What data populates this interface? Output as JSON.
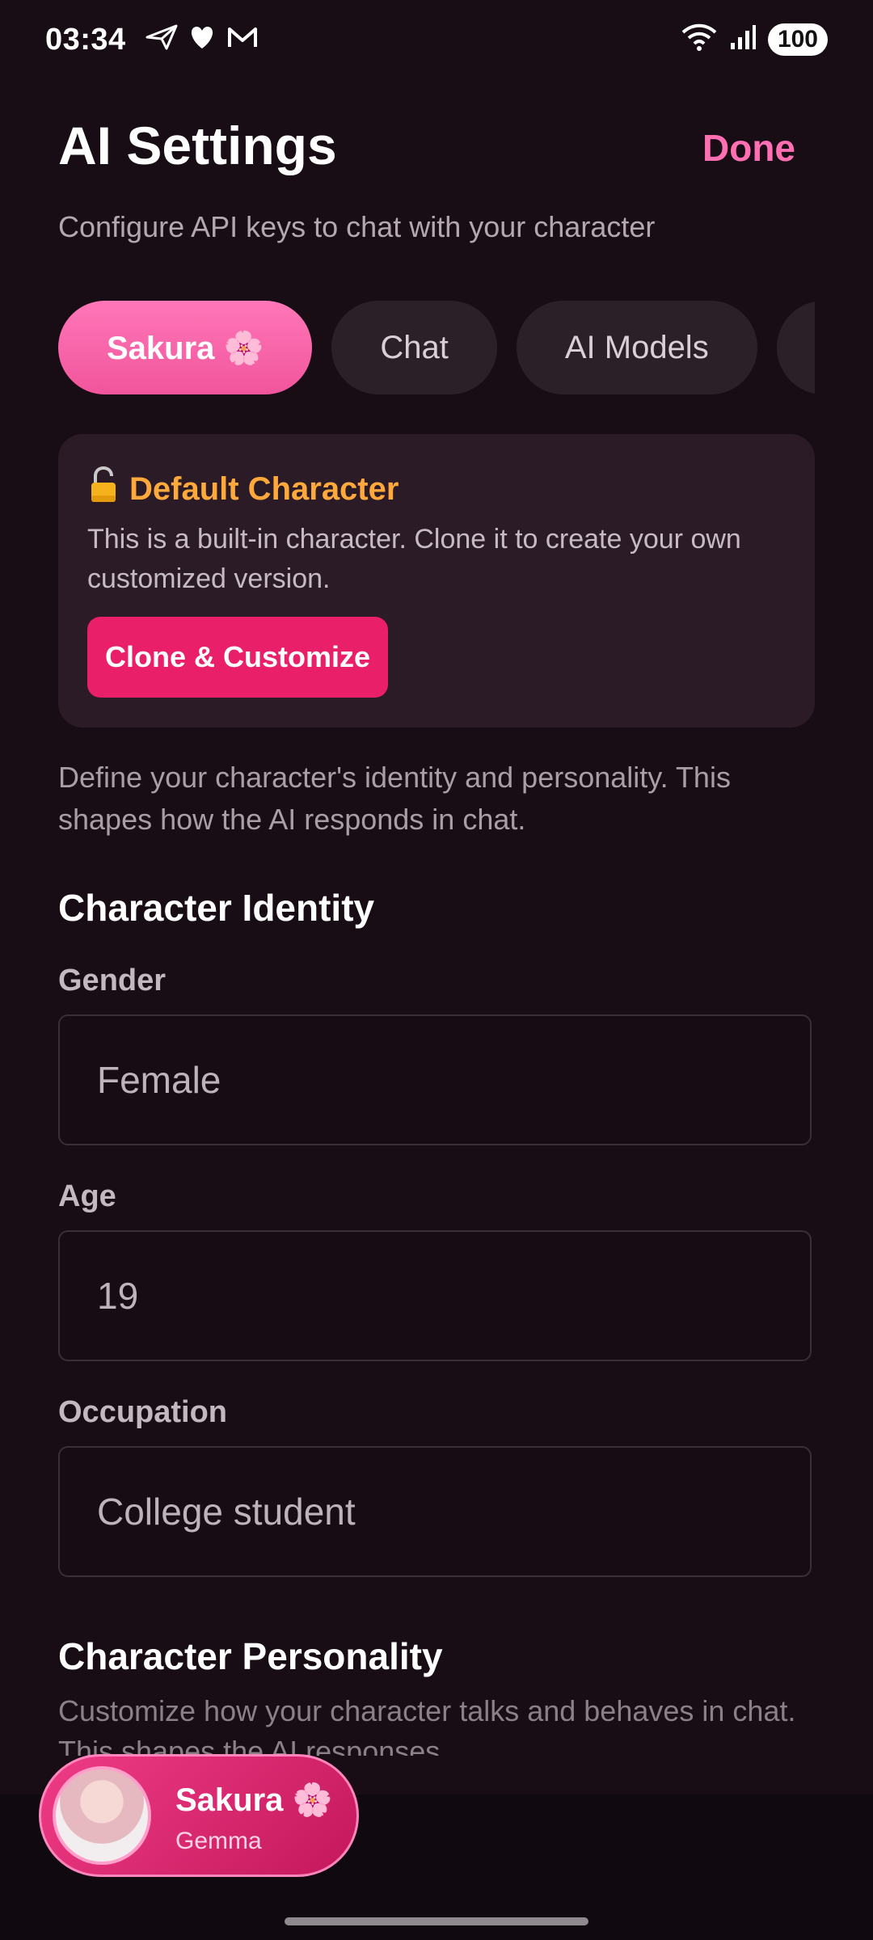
{
  "status_bar": {
    "time": "03:34",
    "left_icons": [
      "send-icon",
      "heart-icon",
      "mail-icon"
    ],
    "right_icons": [
      "wifi-icon",
      "signal-icon"
    ],
    "battery": "100"
  },
  "header": {
    "title": "AI Settings",
    "done_label": "Done",
    "subtitle": "Configure API keys to chat with your character"
  },
  "tabs": [
    {
      "label": "Sakura 🌸",
      "active": true
    },
    {
      "label": "Chat",
      "active": false
    },
    {
      "label": "AI Models",
      "active": false
    },
    {
      "label": "",
      "active": false
    }
  ],
  "default_card": {
    "icon": "lock-icon",
    "title": "Default Character",
    "text": "This is a built-in character. Clone it to create your own customized version.",
    "button_label": "Clone & Customize"
  },
  "intro_text": "Define your character's identity and personality. This shapes how the AI responds in chat.",
  "identity": {
    "heading": "Character Identity",
    "gender": {
      "label": "Gender",
      "value": "Female"
    },
    "age": {
      "label": "Age",
      "value": "19"
    },
    "occupation": {
      "label": "Occupation",
      "value": "College student"
    }
  },
  "personality": {
    "heading": "Character Personality",
    "text": "Customize how your character talks and behaves in chat. This shapes the AI responses."
  },
  "bottom": {
    "character_name": "Sakura 🌸",
    "model_name": "Gemma"
  },
  "colors": {
    "background": "#180c15",
    "accent_pink": "#ff6fb2",
    "button_pink": "#e91f69",
    "warning_orange": "#ffa93c"
  }
}
